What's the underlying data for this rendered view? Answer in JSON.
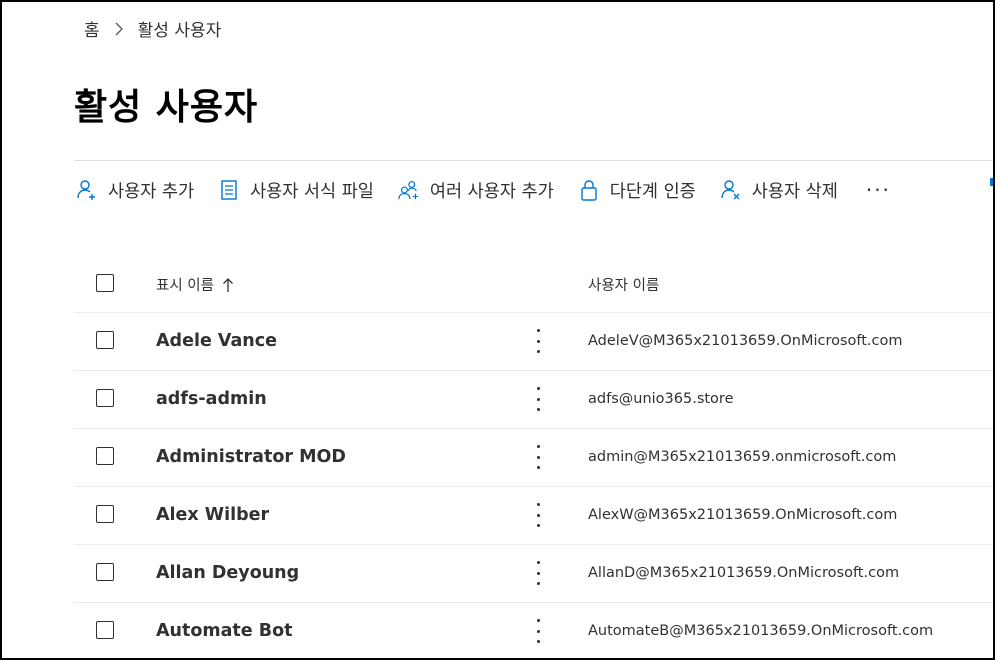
{
  "breadcrumb": {
    "home": "홈",
    "current": "활성 사용자"
  },
  "page": {
    "title": "활성 사용자"
  },
  "toolbar": {
    "add_user": "사용자 추가",
    "user_template": "사용자 서식 파일",
    "add_multiple": "여러 사용자 추가",
    "mfa": "다단계 인증",
    "delete_user": "사용자 삭제",
    "more": "···"
  },
  "grid": {
    "columns": {
      "display_name": "표시 이름",
      "username": "사용자 이름"
    },
    "rows": [
      {
        "display_name": "Adele Vance",
        "username": "AdeleV@M365x21013659.OnMicrosoft.com"
      },
      {
        "display_name": "adfs-admin",
        "username": "adfs@unio365.store"
      },
      {
        "display_name": "Administrator MOD",
        "username": "admin@M365x21013659.onmicrosoft.com"
      },
      {
        "display_name": "Alex Wilber",
        "username": "AlexW@M365x21013659.OnMicrosoft.com"
      },
      {
        "display_name": "Allan Deyoung",
        "username": "AllanD@M365x21013659.OnMicrosoft.com"
      },
      {
        "display_name": "Automate Bot",
        "username": "AutomateB@M365x21013659.OnMicrosoft.com"
      }
    ]
  },
  "colors": {
    "accent": "#0078d4",
    "text": "#323130",
    "divider": "#edebe9"
  }
}
